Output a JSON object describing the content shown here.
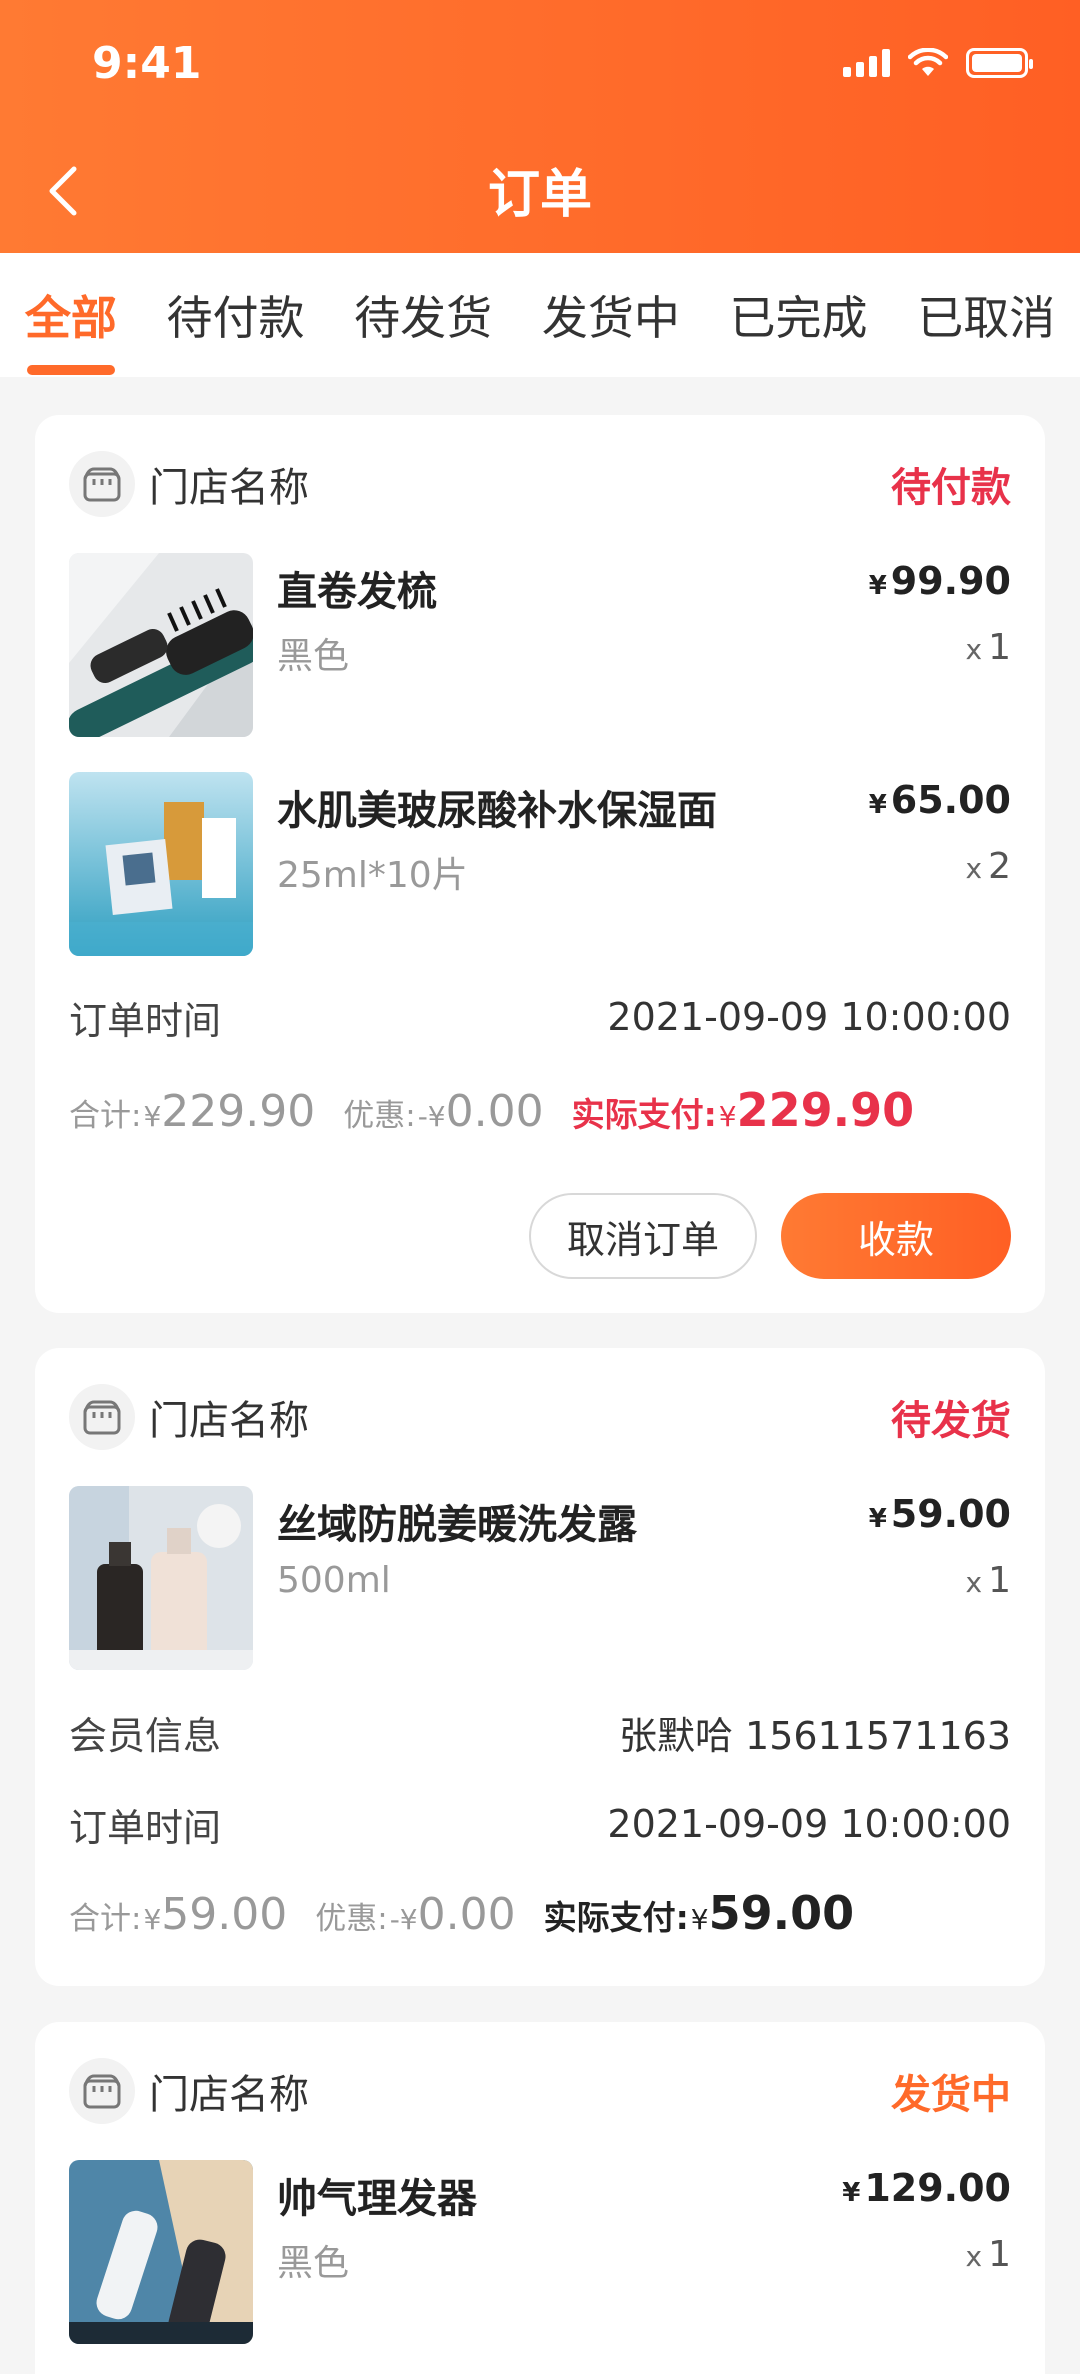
{
  "status_bar": {
    "time": "9:41"
  },
  "header": {
    "title": "订单"
  },
  "tabs": [
    {
      "label": "全部",
      "active": true
    },
    {
      "label": "待付款",
      "active": false
    },
    {
      "label": "待发货",
      "active": false
    },
    {
      "label": "发货中",
      "active": false
    },
    {
      "label": "已完成",
      "active": false
    },
    {
      "label": "已取消",
      "active": false
    }
  ],
  "colors": {
    "accent": "#ff6a2a",
    "status_red": "#e8324a"
  },
  "orders": [
    {
      "store_name": "门店名称",
      "status": "待付款",
      "items": [
        {
          "name": "直卷发梳",
          "spec": "黑色",
          "currency": "¥",
          "price": "99.90",
          "qty_prefix": "x",
          "qty": "1",
          "image": "hair-brush"
        },
        {
          "name": "水肌美玻尿酸补水保湿面",
          "spec": "25ml*10片",
          "currency": "¥",
          "price": "65.00",
          "qty_prefix": "x",
          "qty": "2",
          "image": "face-mask"
        }
      ],
      "order_time_label": "订单时间",
      "order_time": "2021-09-09 10:00:00",
      "total_label": "合计:",
      "total": "229.90",
      "discount_label": "优惠:",
      "discount_prefix": "-¥",
      "discount": "0.00",
      "paid_label": "实际支付:",
      "paid": "229.90",
      "currency": "¥",
      "cancel_label": "取消订单",
      "collect_label": "收款"
    },
    {
      "store_name": "门店名称",
      "status": "待发货",
      "items": [
        {
          "name": "丝域防脱姜暖洗发露",
          "spec": "500ml",
          "currency": "¥",
          "price": "59.00",
          "qty_prefix": "x",
          "qty": "1",
          "image": "shampoo"
        }
      ],
      "member_label": "会员信息",
      "member_info": "张默哈 15611571163",
      "order_time_label": "订单时间",
      "order_time": "2021-09-09 10:00:00",
      "total_label": "合计:",
      "total": "59.00",
      "discount_label": "优惠:",
      "discount_prefix": "-¥",
      "discount": "0.00",
      "paid_label": "实际支付:",
      "paid": "59.00",
      "currency": "¥"
    },
    {
      "store_name": "门店名称",
      "status": "发货中",
      "items": [
        {
          "name": "帅气理发器",
          "spec": "黑色",
          "currency": "¥",
          "price": "129.00",
          "qty_prefix": "x",
          "qty": "1",
          "image": "hair-clipper"
        }
      ]
    }
  ]
}
